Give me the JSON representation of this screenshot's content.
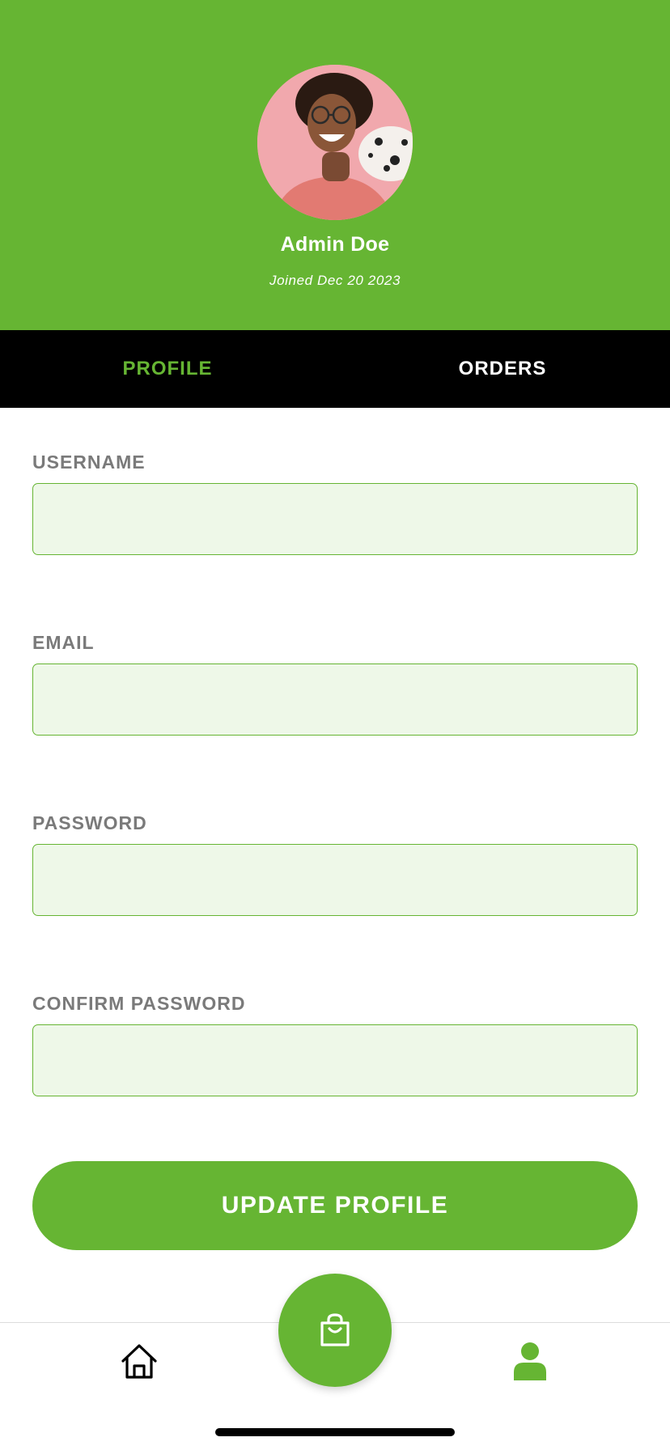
{
  "profile": {
    "name": "Admin Doe",
    "joined": "Joined Dec 20 2023"
  },
  "tabs": [
    {
      "label": "PROFILE",
      "active": true
    },
    {
      "label": "ORDERS",
      "active": false
    }
  ],
  "form": {
    "username": {
      "label": "USERNAME",
      "value": "",
      "placeholder": ""
    },
    "email": {
      "label": "EMAIL",
      "value": "",
      "placeholder": ""
    },
    "password": {
      "label": "PASSWORD",
      "value": "",
      "placeholder": ""
    },
    "confirm_password": {
      "label": "CONFIRM PASSWORD",
      "value": "",
      "placeholder": ""
    },
    "submit_label": "UPDATE PROFILE"
  },
  "bottom_nav": {
    "items": [
      {
        "icon": "home-icon",
        "active": false
      },
      {
        "icon": "shopping-bag-icon",
        "active": false
      },
      {
        "icon": "user-icon",
        "active": true
      }
    ]
  },
  "colors": {
    "accent": "#66b533",
    "input_bg": "#eef8e8",
    "tab_bar": "#000000",
    "label": "#7a7a7a"
  }
}
